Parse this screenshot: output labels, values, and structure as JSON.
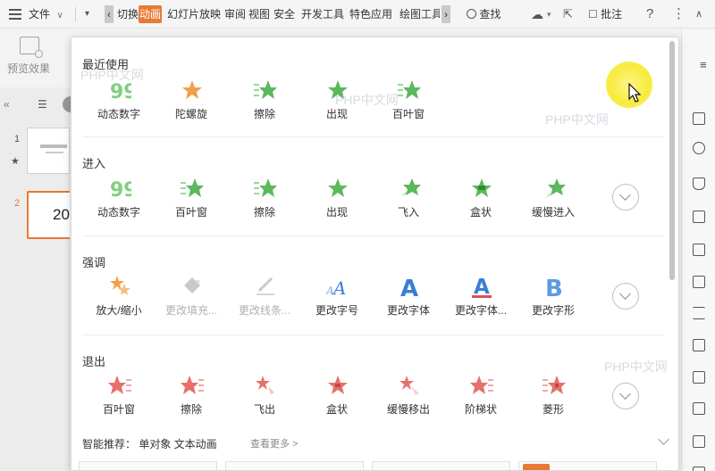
{
  "toolbar": {
    "file_label": "文件",
    "tabs": [
      "切换",
      "动画",
      "幻灯片放映",
      "审阅",
      "视图",
      "安全",
      "开发工具",
      "特色应用",
      "绘图工具"
    ],
    "search_label": "查找",
    "comment_label": "批注",
    "help_label": "?",
    "more_label": "⋮",
    "accent": "#e87a35"
  },
  "ribbon": {
    "preview_label": "预览效果"
  },
  "slides": {
    "numbers": [
      "1",
      "2"
    ],
    "slide2_text": "20"
  },
  "panel": {
    "sections": [
      {
        "title": "最近使用",
        "items": [
          "动态数字",
          "陀螺旋",
          "擦除",
          "出现",
          "百叶窗"
        ]
      },
      {
        "title": "进入",
        "items": [
          "动态数字",
          "百叶窗",
          "擦除",
          "出现",
          "飞入",
          "盒状",
          "缓慢进入"
        ]
      },
      {
        "title": "强调",
        "items": [
          "放大/缩小",
          "更改填充...",
          "更改线条...",
          "更改字号",
          "更改字体",
          "更改字体...",
          "更改字形"
        ]
      },
      {
        "title": "退出",
        "items": [
          "百叶窗",
          "擦除",
          "飞出",
          "盒状",
          "缓慢移出",
          "阶梯状",
          "菱形"
        ]
      }
    ],
    "smart_label": "智能推荐： 单对象 文本动画",
    "smart_more": "查看更多 >"
  },
  "watermark": "PHP中文网",
  "colors": {
    "green_star": "#5cb85c",
    "orange_star": "#f0a04b",
    "red_star": "#e8706a",
    "blue_letter": "#3b7fd4"
  }
}
